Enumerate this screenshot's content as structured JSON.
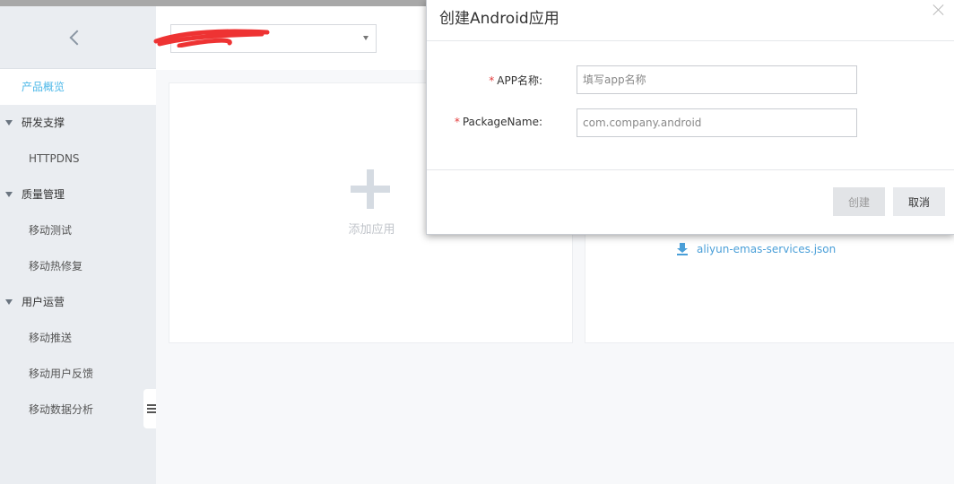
{
  "sidebar": {
    "items": [
      {
        "label": "产品概览",
        "kind": "active"
      },
      {
        "label": "研发支撑",
        "kind": "group"
      },
      {
        "label": "HTTPDNS",
        "kind": "sub"
      },
      {
        "label": "质量管理",
        "kind": "group"
      },
      {
        "label": "移动测试",
        "kind": "sub"
      },
      {
        "label": "移动热修复",
        "kind": "sub"
      },
      {
        "label": "用户运营",
        "kind": "group"
      },
      {
        "label": "移动推送",
        "kind": "sub"
      },
      {
        "label": "移动用户反馈",
        "kind": "sub"
      },
      {
        "label": "移动数据分析",
        "kind": "sub"
      }
    ]
  },
  "cards": {
    "add_app_label": "添加应用",
    "config_file": "aliyun-emas-services.json"
  },
  "dialog": {
    "title": "创建Android应用",
    "app_name_label": "APP名称:",
    "app_name_placeholder": "填写app名称",
    "package_label": "PackageName:",
    "package_placeholder": "com.company.android",
    "create_button": "创建",
    "cancel_button": "取消"
  },
  "colors": {
    "accent": "#4db8e8",
    "link": "#4a9fd8",
    "required": "#e23b3b",
    "sidebar_bg": "#eaedf1"
  }
}
